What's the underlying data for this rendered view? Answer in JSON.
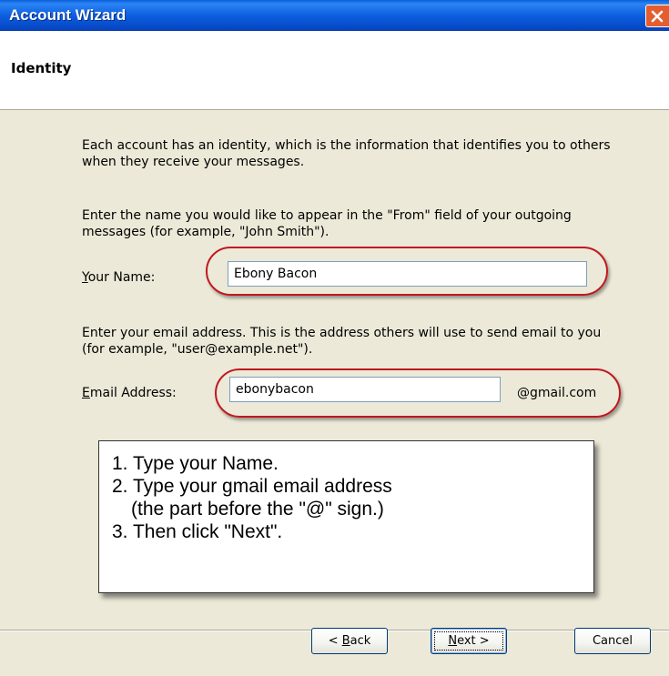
{
  "window": {
    "title": "Account Wizard"
  },
  "header": {
    "title": "Identity"
  },
  "intro": "Each account has an identity, which is the information that identifies you to others when they receive your messages.",
  "name_section": {
    "description": "Enter the name you would like to appear in the \"From\" field of your outgoing messages (for example, \"John Smith\").",
    "label_accel": "Y",
    "label_rest": "our Name:",
    "value": "Ebony Bacon"
  },
  "email_section": {
    "description": "Enter your email address. This is the address others will use to send email to you (for example, \"user@example.net\").",
    "label_accel": "E",
    "label_rest": "mail Address:",
    "value": "ebonybacon",
    "suffix": "@gmail.com"
  },
  "instructions": [
    "1. Type your Name.",
    "2. Type your gmail email address",
    "(the part before the \"@\" sign.)",
    "3. Then click \"Next\"."
  ],
  "buttons": {
    "back_prefix": "< ",
    "back_accel": "B",
    "back_rest": "ack",
    "next_accel": "N",
    "next_rest": "ext >",
    "cancel": "Cancel"
  },
  "colors": {
    "titlebar": "#0d5fe0",
    "highlight_oval": "#c01820",
    "close_button": "#e35d2f"
  }
}
